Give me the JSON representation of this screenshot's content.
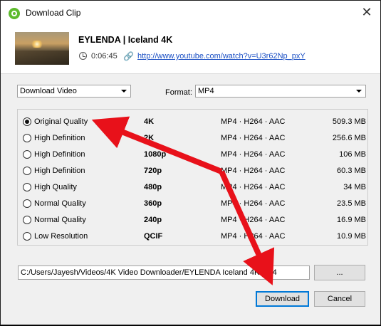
{
  "window": {
    "title": "Download Clip",
    "close_glyph": "✕"
  },
  "clip": {
    "title": "EYLENDA | Iceland 4K",
    "duration": "0:06:45",
    "url": "http://www.youtube.com/watch?v=U3r62Np_pxY"
  },
  "options": {
    "mode": "Download Video",
    "format_label": "Format:",
    "format_value": "MP4"
  },
  "qualities": [
    {
      "label": "Original Quality",
      "resolution": "4K",
      "codec": "MP4 · H264 · AAC",
      "size": "509.3 MB",
      "selected": true
    },
    {
      "label": "High Definition",
      "resolution": "2K",
      "codec": "MP4 · H264 · AAC",
      "size": "256.6 MB",
      "selected": false
    },
    {
      "label": "High Definition",
      "resolution": "1080p",
      "codec": "MP4 · H264 · AAC",
      "size": "106 MB",
      "selected": false
    },
    {
      "label": "High Definition",
      "resolution": "720p",
      "codec": "MP4 · H264 · AAC",
      "size": "60.3 MB",
      "selected": false
    },
    {
      "label": "High Quality",
      "resolution": "480p",
      "codec": "MP4 · H264 · AAC",
      "size": "34 MB",
      "selected": false
    },
    {
      "label": "Normal Quality",
      "resolution": "360p",
      "codec": "MP4 · H264 · AAC",
      "size": "23.5 MB",
      "selected": false
    },
    {
      "label": "Normal Quality",
      "resolution": "240p",
      "codec": "MP4 · H264 · AAC",
      "size": "16.9 MB",
      "selected": false
    },
    {
      "label": "Low Resolution",
      "resolution": "QCIF",
      "codec": "MP4 · H264 · AAC",
      "size": "10.9 MB",
      "selected": false
    }
  ],
  "save": {
    "path": "C:/Users/Jayesh/Videos/4K Video Downloader/EYLENDA   Iceland 4K.mp4",
    "browse_label": "..."
  },
  "buttons": {
    "download": "Download",
    "cancel": "Cancel"
  },
  "colors": {
    "accent": "#0078d7",
    "annotation_arrow": "#e8111a",
    "link": "#1a4fc4",
    "app_icon": "#5dbb2c"
  },
  "icons": {
    "app": "app-logo-icon",
    "clock": "clock-icon",
    "link": "link-icon",
    "close": "close-icon"
  }
}
